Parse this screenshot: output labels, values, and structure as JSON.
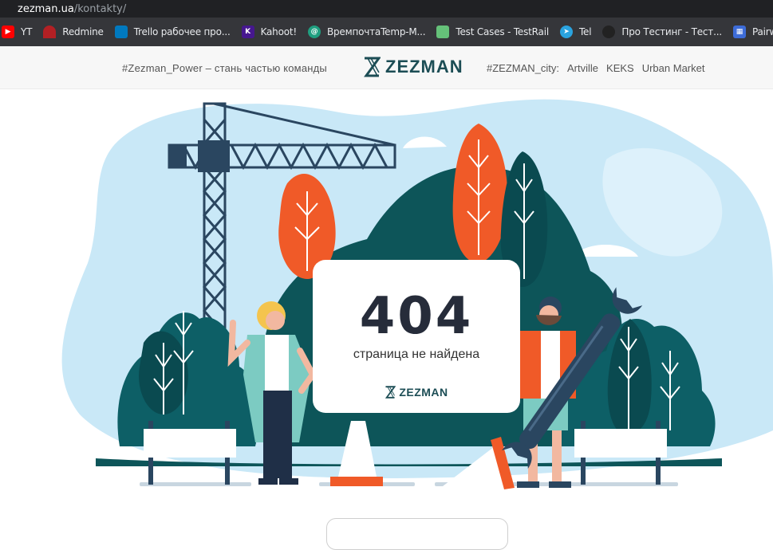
{
  "browser": {
    "url_host": "zezman.ua",
    "url_path": "/kontakty/"
  },
  "bookmarks": [
    {
      "label": "YT",
      "icon": "youtube-icon",
      "color": "#ff0000"
    },
    {
      "label": "Redmine",
      "icon": "redmine-icon",
      "color": "#b32024"
    },
    {
      "label": "Trello рабочее про...",
      "icon": "trello-icon",
      "color": "#0079bf"
    },
    {
      "label": "Kahoot!",
      "icon": "kahoot-icon",
      "color": "#46178f"
    },
    {
      "label": "ВремпочтаTemp-M...",
      "icon": "tempmail-icon",
      "color": "#1f9f80"
    },
    {
      "label": "Test Cases - TestRail",
      "icon": "testrail-icon",
      "color": "#65c179"
    },
    {
      "label": "Tel",
      "icon": "telegram-icon",
      "color": "#2aa3df"
    },
    {
      "label": "Про Тестинг - Тест...",
      "icon": "protesting-icon",
      "color": "#222222"
    },
    {
      "label": "Pairwise Onl",
      "icon": "pairwise-icon",
      "color": "#3d6cd8"
    }
  ],
  "header": {
    "tagline": "#Zezman_Power – стань частью команды",
    "logo_text": "ZEZMAN",
    "city_label": "#ZEZMAN_city:",
    "city_links": [
      "Artville",
      "KEKS",
      "Urban Market"
    ]
  },
  "error_card": {
    "code": "404",
    "message": "страница не найдена",
    "logo_text": "ZEZMAN"
  },
  "colors": {
    "brand": "#1c4d55",
    "sky": "#c9e8f7",
    "dark_green": "#0d5559",
    "orange": "#f05a28",
    "crane": "#2a4660"
  }
}
